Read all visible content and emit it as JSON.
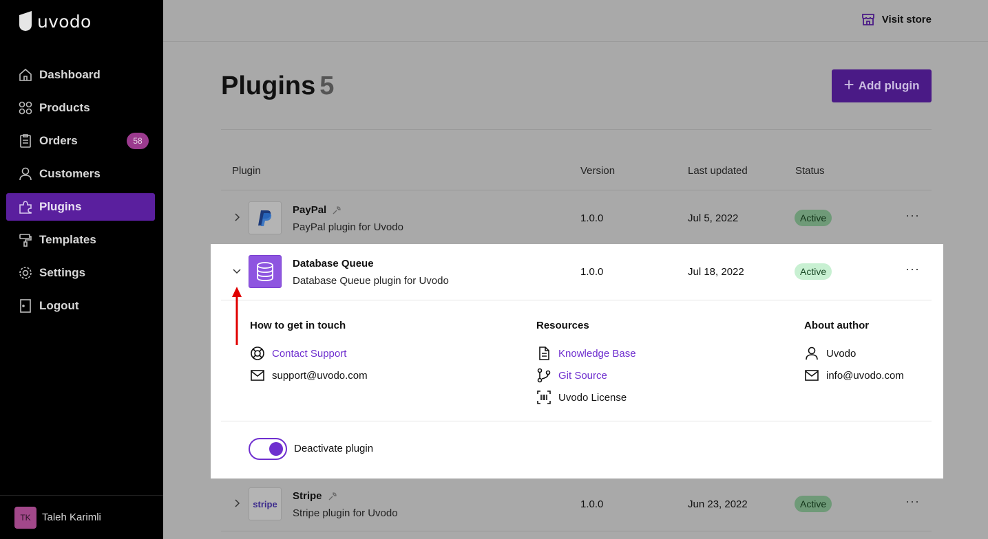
{
  "app": {
    "logo_text": "uvodo"
  },
  "sidebar": {
    "items": [
      {
        "label": "Dashboard",
        "icon": "home-icon"
      },
      {
        "label": "Products",
        "icon": "grid-icon"
      },
      {
        "label": "Orders",
        "icon": "clipboard-icon",
        "badge": "58"
      },
      {
        "label": "Customers",
        "icon": "user-icon"
      },
      {
        "label": "Plugins",
        "icon": "puzzle-icon",
        "active": true
      },
      {
        "label": "Templates",
        "icon": "paint-roller-icon"
      },
      {
        "label": "Settings",
        "icon": "gear-icon"
      },
      {
        "label": "Logout",
        "icon": "door-icon"
      }
    ],
    "user": {
      "initials": "TK",
      "name": "Taleh Karimli"
    }
  },
  "topbar": {
    "visit_store": "Visit store"
  },
  "page": {
    "title": "Plugins",
    "count": "5",
    "add_button": "Add plugin"
  },
  "table": {
    "headers": {
      "plugin": "Plugin",
      "version": "Version",
      "last_updated": "Last updated",
      "status": "Status"
    },
    "rows": [
      {
        "name": "PayPal",
        "description": "PayPal plugin for Uvodo",
        "version": "1.0.0",
        "updated": "Jul 5, 2022",
        "status": "Active"
      },
      {
        "name": "Database Queue",
        "description": "Database Queue plugin for Uvodo",
        "version": "1.0.0",
        "updated": "Jul 18, 2022",
        "status": "Active",
        "expanded": true
      },
      {
        "name": "Stripe",
        "description": "Stripe plugin for Uvodo",
        "version": "1.0.0",
        "updated": "Jun 23, 2022",
        "status": "Active",
        "logo_text": "stripe"
      }
    ]
  },
  "details": {
    "contact": {
      "title": "How to get in touch",
      "support_link": "Contact Support",
      "email": "support@uvodo.com"
    },
    "resources": {
      "title": "Resources",
      "knowledge_base": "Knowledge Base",
      "git_source": "Git Source",
      "license": "Uvodo License"
    },
    "author": {
      "title": "About author",
      "name": "Uvodo",
      "email": "info@uvodo.com"
    },
    "toggle_label": "Deactivate plugin",
    "toggle_on": true
  },
  "colors": {
    "accent": "#6f2fcf",
    "active_badge": "#c8f0d2",
    "annotation_arrow": "#e00000"
  }
}
